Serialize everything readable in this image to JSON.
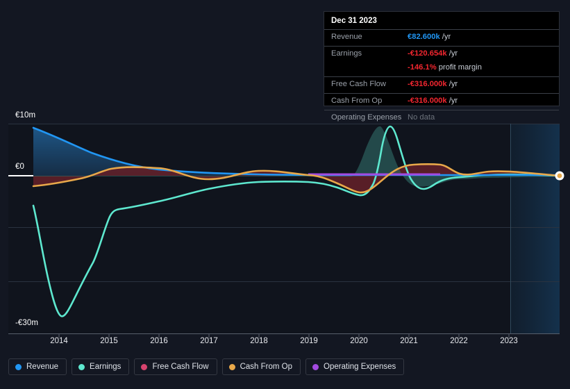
{
  "tooltip": {
    "date": "Dec 31 2023",
    "rows": [
      {
        "label": "Revenue",
        "value": "€82.600k",
        "unit": "/yr",
        "color": "#2196f3"
      },
      {
        "label": "Earnings",
        "value": "-€120.654k",
        "unit": "/yr",
        "color": "#f3262f"
      },
      {
        "label": "",
        "value": "-146.1%",
        "unit": "profit margin",
        "color": "#f3262f"
      },
      {
        "label": "Free Cash Flow",
        "value": "-€316.000k",
        "unit": "/yr",
        "color": "#f3262f"
      },
      {
        "label": "Cash From Op",
        "value": "-€316.000k",
        "unit": "/yr",
        "color": "#f3262f"
      },
      {
        "label": "Operating Expenses",
        "value": "No data",
        "unit": "",
        "color": "#6d737c"
      }
    ]
  },
  "legend": {
    "items": [
      {
        "label": "Revenue",
        "color": "#2196f3"
      },
      {
        "label": "Earnings",
        "color": "#5ee8cf"
      },
      {
        "label": "Free Cash Flow",
        "color": "#d6436e"
      },
      {
        "label": "Cash From Op",
        "color": "#e8a84a"
      },
      {
        "label": "Operating Expenses",
        "color": "#a24ae0"
      }
    ]
  },
  "chart_data": {
    "type": "area",
    "title": "",
    "xlabel": "",
    "ylabel": "",
    "currency": "EUR",
    "ylim": [
      -30000000,
      10000000
    ],
    "yticks": [
      10000000,
      0,
      -30000000
    ],
    "ytick_labels": [
      "€10m",
      "€0",
      "-€30m"
    ],
    "gridlines_y": [
      10000000,
      0,
      -12000000,
      -21000000
    ],
    "x": [
      "2013.6",
      "2014",
      "2015",
      "2016",
      "2017",
      "2018",
      "2019",
      "2020",
      "2021",
      "2022",
      "2023",
      "2023.9"
    ],
    "xtick_labels": [
      "2014",
      "2015",
      "2016",
      "2017",
      "2018",
      "2019",
      "2020",
      "2021",
      "2022",
      "2023"
    ],
    "highlight_band": {
      "from": "2022.6",
      "to": "2023.9",
      "label": ""
    },
    "series": [
      {
        "name": "Revenue",
        "color": "#2196f3",
        "fill": "#1b4567",
        "values": [
          9600000,
          7400000,
          3500000,
          1100000,
          450000,
          330000,
          300000,
          260000,
          200000,
          150000,
          110000,
          82600
        ]
      },
      {
        "name": "Earnings",
        "color": "#5ee8cf",
        "fill": "#2f6a66",
        "values": [
          -7400000,
          -29200000,
          -21600000,
          -4500000,
          -2300000,
          -1800000,
          -1600000,
          -2600000,
          6200000,
          -1500000,
          -400000,
          -120654
        ]
      },
      {
        "name": "Free Cash Flow",
        "color": "#d6436e",
        "fill": "#6d2028",
        "values": [
          -3200000,
          -2100000,
          700000,
          750000,
          200000,
          -100000,
          -700000,
          -2900000,
          2100000,
          2000000,
          -350000,
          -316000
        ]
      },
      {
        "name": "Cash From Op",
        "color": "#e8a84a",
        "fill": "#6d2028",
        "values": [
          -3200000,
          -2100000,
          700000,
          750000,
          200000,
          -100000,
          -700000,
          -2900000,
          2100000,
          2000000,
          -350000,
          -316000
        ]
      },
      {
        "name": "Operating Expenses",
        "color": "#a24ae0",
        "fill": "none",
        "values": [
          null,
          null,
          null,
          null,
          null,
          null,
          null,
          0,
          0,
          0,
          null,
          null
        ]
      }
    ]
  }
}
